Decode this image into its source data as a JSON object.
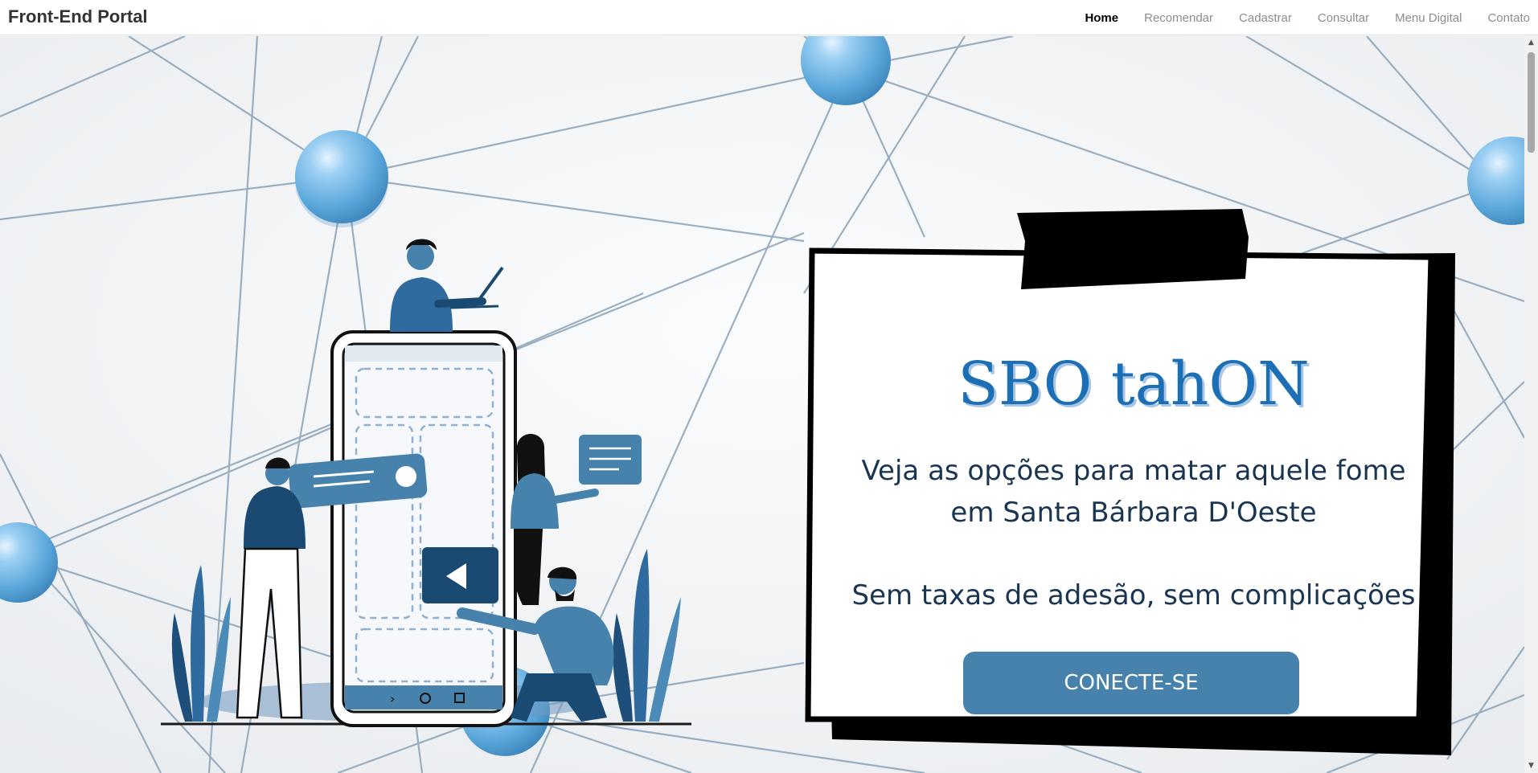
{
  "navbar": {
    "brand": "Front-End Portal",
    "links": [
      "Home",
      "Recomendar",
      "Cadastrar",
      "Consultar",
      "Menu Digital",
      "Contato"
    ]
  },
  "hero": {
    "title": "SBO tahON",
    "line1": "Veja as opções para matar aquele fome",
    "line2": "em Santa Bárbara D'Oeste",
    "line3": "Sem taxas de adesão, sem complicações",
    "cta_label": "CONECTE-SE"
  },
  "colors": {
    "accent": "#4782ad",
    "title_blue": "#1d6fb5",
    "text_dark": "#1a3552"
  }
}
